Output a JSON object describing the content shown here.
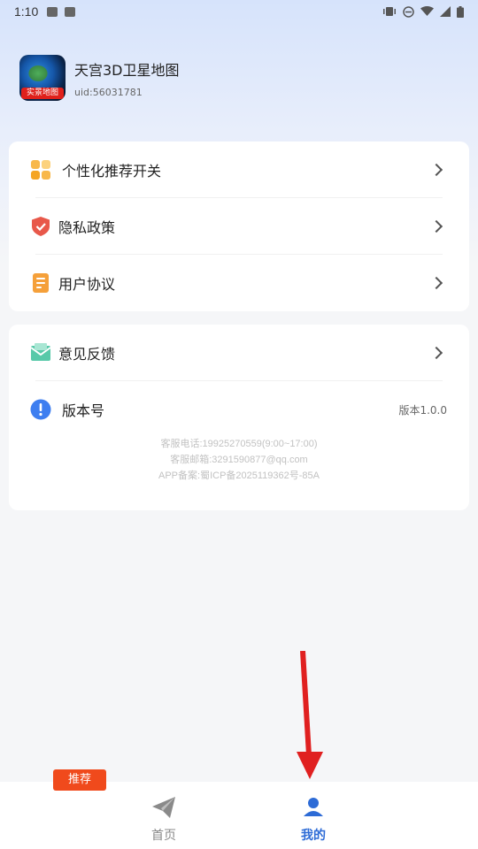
{
  "status_bar": {
    "time": "1:10"
  },
  "profile": {
    "app_name": "天宫3D卫星地图",
    "uid": "uid:56031781",
    "logo_tag": "实景地图"
  },
  "menu_group_1": [
    {
      "label": "个性化推荐开关",
      "icon": "grid-icon"
    },
    {
      "label": "隐私政策",
      "icon": "shield-icon"
    },
    {
      "label": "用户协议",
      "icon": "document-icon"
    }
  ],
  "menu_group_2": [
    {
      "label": "意见反馈",
      "icon": "mail-icon"
    },
    {
      "label": "版本号",
      "icon": "info-icon",
      "value": "版本1.0.0"
    }
  ],
  "footer": {
    "phone": "客服电话:19925270559(9:00~17:00)",
    "email": "客服邮箱:3291590877@qq.com",
    "icp": "APP备案:蜀ICP备2025119362号-85A"
  },
  "bottom_nav": {
    "badge": "推荐",
    "tabs": [
      {
        "label": "首页",
        "icon": "paper-plane-icon",
        "active": false
      },
      {
        "label": "我的",
        "icon": "user-icon",
        "active": true
      }
    ]
  },
  "colors": {
    "accent": "#2d6bd6",
    "badge": "#f04a1c",
    "annotation_arrow": "#e02020"
  }
}
